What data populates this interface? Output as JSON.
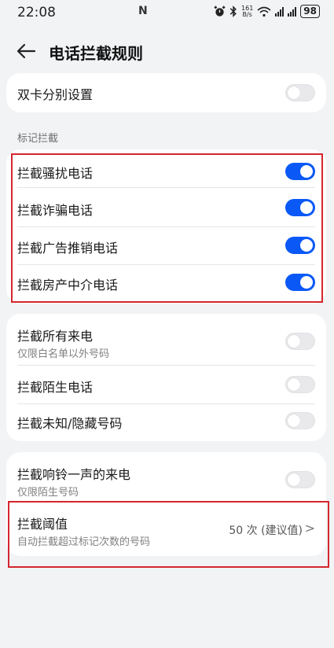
{
  "status_bar": {
    "time": "22:08",
    "nfc": "N",
    "speed_top": "161",
    "speed_bottom": "B/s",
    "battery": "98"
  },
  "header": {
    "title": "电话拦截规则"
  },
  "dual_sim": {
    "label": "双卡分别设置",
    "on": false
  },
  "section_marked": "标记拦截",
  "marked_items": [
    {
      "label": "拦截骚扰电话",
      "on": true
    },
    {
      "label": "拦截诈骗电话",
      "on": true
    },
    {
      "label": "拦截广告推销电话",
      "on": true
    },
    {
      "label": "拦截房产中介电话",
      "on": true
    }
  ],
  "block_group": [
    {
      "label": "拦截所有来电",
      "sub": "仅限白名单以外号码",
      "on": false
    },
    {
      "label": "拦截陌生电话",
      "on": false
    },
    {
      "label": "拦截未知/隐藏号码",
      "on": false
    }
  ],
  "ring_once": {
    "label": "拦截响铃一声的来电",
    "sub": "仅限陌生号码",
    "on": false
  },
  "threshold": {
    "label": "拦截阈值",
    "sub": "自动拦截超过标记次数的号码",
    "value": "50 次 (建议值)",
    "chevron": ">"
  },
  "colors": {
    "accent": "#0a59f7",
    "highlight": "#d4262e",
    "background": "#f1f3f5"
  }
}
